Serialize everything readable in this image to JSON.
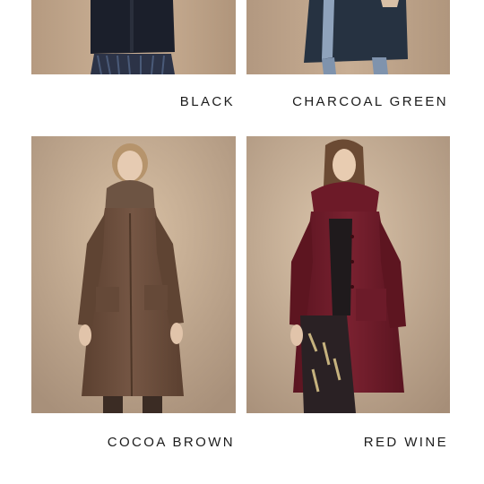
{
  "colors": {
    "background": "#ffffff",
    "label_text": "#1c1c1c",
    "backdrop": "#bda287",
    "black_coat": "#1b1f2b",
    "charcoal_green_coat": "#263241",
    "cocoa_brown_coat": "#6a4c39",
    "red_wine_coat": "#6a1a26"
  },
  "swatches": [
    {
      "label": "BLACK",
      "icon": "coat-photo"
    },
    {
      "label": "CHARCOAL GREEN",
      "icon": "coat-photo"
    },
    {
      "label": "COCOA BROWN",
      "icon": "coat-photo"
    },
    {
      "label": "RED WINE",
      "icon": "coat-photo"
    }
  ]
}
